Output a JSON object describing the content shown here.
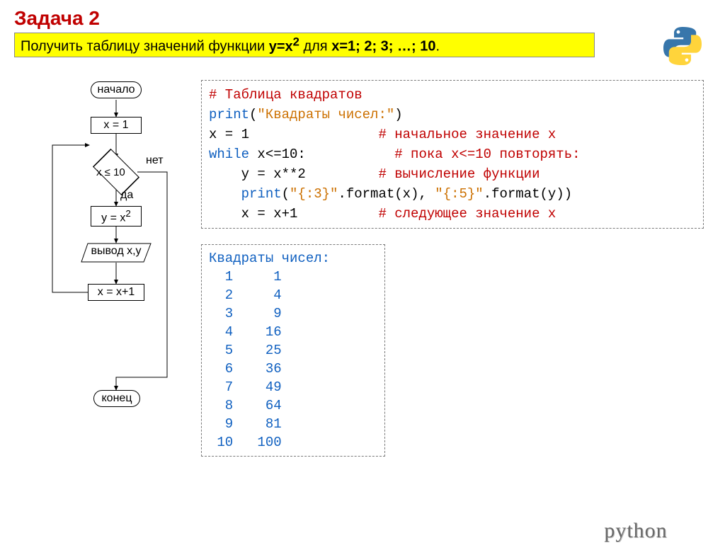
{
  "title": "Задача 2",
  "subtitle": {
    "pre": "Получить таблицу значений функции ",
    "func_lhs": "y=x",
    "func_exp": "2",
    "mid": " для ",
    "xs": "x=1; 2; 3; …; 10",
    "end": "."
  },
  "flowchart": {
    "start": "начало",
    "s1": "x = 1",
    "cond": "x ≤ 10",
    "no": "нет",
    "yes": "да",
    "s2_l": "y = x",
    "s2_exp": "2",
    "out": "вывод x,y",
    "s3": "x = x+1",
    "end": "конец"
  },
  "code": {
    "l1a": "# Таблица квадратов",
    "l2a": "print",
    "l2b": "(",
    "l2c": "\"Квадраты чисел:\"",
    "l2d": ")",
    "l3a": "x = 1                ",
    "l3b": "# начальное значение x",
    "l4a": "while",
    "l4b": " x<=10:           ",
    "l4c": "# пока x<=10 повторять:",
    "l5a": "    y = x**2         ",
    "l5b": "# вычисление функции",
    "l6a": "    ",
    "l6b": "print",
    "l6c": "(",
    "l6d": "\"{:3}\"",
    "l6e": ".format(x), ",
    "l6f": "\"{:5}\"",
    "l6g": ".format(y))",
    "l7a": "    x = x+1          ",
    "l7b": "# следующее значение x"
  },
  "output": {
    "header": "Квадраты чисел:",
    "rows": [
      "  1     1",
      "  2     4",
      "  3     9",
      "  4    16",
      "  5    25",
      "  6    36",
      "  7    49",
      "  8    64",
      "  9    81",
      " 10   100"
    ]
  },
  "footer": "python",
  "colors": {
    "red": "#c00000",
    "blue": "#1060c0",
    "orange": "#cc7000",
    "yellow": "#ffff00"
  }
}
